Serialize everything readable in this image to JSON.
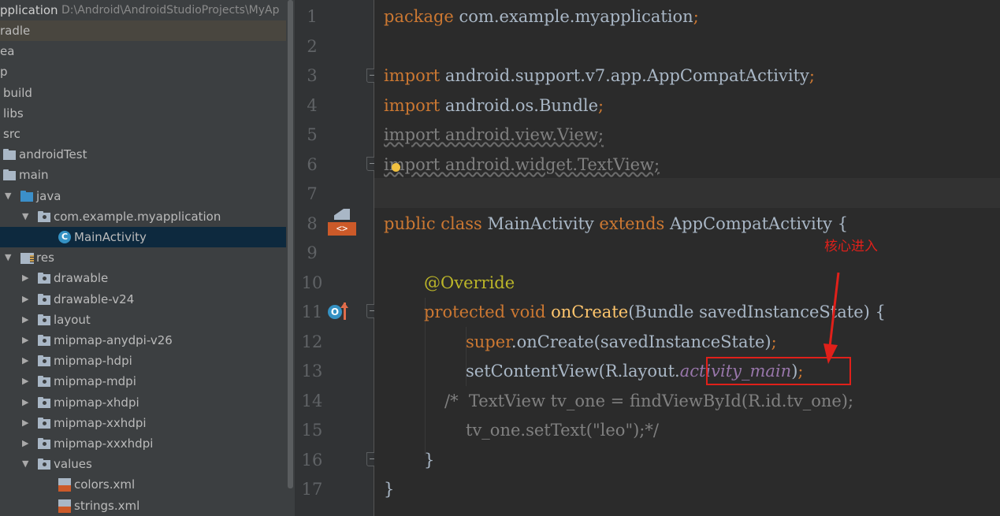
{
  "project": {
    "header_title": "pplication",
    "header_path": "D:\\Android\\AndroidStudioProjects\\MyAp",
    "items": [
      {
        "label": "radle",
        "icon": "none",
        "arrow": ""
      },
      {
        "label": "ea",
        "icon": "none",
        "arrow": ""
      },
      {
        "label": "p",
        "icon": "none",
        "arrow": ""
      },
      {
        "label": "build",
        "icon": "none",
        "arrow": ""
      },
      {
        "label": "libs",
        "icon": "none",
        "arrow": ""
      },
      {
        "label": "src",
        "icon": "none",
        "arrow": ""
      },
      {
        "label": "androidTest",
        "icon": "folder",
        "arrow": ""
      },
      {
        "label": "main",
        "icon": "folder",
        "arrow": ""
      },
      {
        "label": "java",
        "icon": "folder-blue",
        "arrow": "expanded"
      },
      {
        "label": "com.example.myapplication",
        "icon": "package-folder",
        "arrow": "expanded"
      },
      {
        "label": "MainActivity",
        "icon": "class-icon",
        "arrow": "",
        "badge": "C"
      },
      {
        "label": "res",
        "icon": "resource-folder",
        "arrow": "expanded"
      },
      {
        "label": "drawable",
        "icon": "package-folder",
        "arrow": "collapsed"
      },
      {
        "label": "drawable-v24",
        "icon": "package-folder",
        "arrow": "collapsed"
      },
      {
        "label": "layout",
        "icon": "package-folder",
        "arrow": "collapsed"
      },
      {
        "label": "mipmap-anydpi-v26",
        "icon": "package-folder",
        "arrow": "collapsed"
      },
      {
        "label": "mipmap-hdpi",
        "icon": "package-folder",
        "arrow": "collapsed"
      },
      {
        "label": "mipmap-mdpi",
        "icon": "package-folder",
        "arrow": "collapsed"
      },
      {
        "label": "mipmap-xhdpi",
        "icon": "package-folder",
        "arrow": "collapsed"
      },
      {
        "label": "mipmap-xxhdpi",
        "icon": "package-folder",
        "arrow": "collapsed"
      },
      {
        "label": "mipmap-xxxhdpi",
        "icon": "package-folder",
        "arrow": "collapsed"
      },
      {
        "label": "values",
        "icon": "package-folder",
        "arrow": "expanded"
      },
      {
        "label": "colors.xml",
        "icon": "xml-file",
        "arrow": ""
      },
      {
        "label": "strings.xml",
        "icon": "xml-file",
        "arrow": ""
      }
    ]
  },
  "editor": {
    "line_numbers": [
      "1",
      "2",
      "3",
      "4",
      "5",
      "6",
      "7",
      "8",
      "9",
      "10",
      "11",
      "12",
      "13",
      "14",
      "15",
      "16",
      "17"
    ],
    "gutter_icons": {
      "line8": "layout-preview-icon",
      "line11_badge": "O",
      "line11": "override-arrow-icon"
    },
    "lines": {
      "l1_kw": "package",
      "l1_rest": " com.example.myapplication",
      "l1_semi": ";",
      "l3_kw": "import",
      "l3_rest": " android.support.v7.app.AppCompatActivity",
      "l3_semi": ";",
      "l4_kw": "import",
      "l4_rest": " android.os.Bundle",
      "l4_semi": ";",
      "l5": "import android.view.View;",
      "l6": "import android.widget.TextView;",
      "l8_kw1": "public class ",
      "l8_name": "MainActivity ",
      "l8_kw2": "extends ",
      "l8_rest": "AppCompatActivity {",
      "l10": "@Override",
      "l11_kw": "protected void ",
      "l11_fn": "onCreate",
      "l11_rest": "(Bundle savedInstanceState) {",
      "l12_kw": "super",
      "l12_rest": ".onCreate(savedInstanceState)",
      "l12_semi": ";",
      "l13_pre": "setContentView(R.layout.",
      "l13_it": "activity_main",
      "l13_post": ")",
      "l13_semi": ";",
      "l14": "/*  TextView tv_one = findViewById(R.id.tv_one);",
      "l15": "tv_one.setText(\"leo\");*/",
      "l16": "}",
      "l17": "}"
    },
    "annotation_note": "核心进入",
    "colors": {
      "keyword": "#cc7832",
      "annotation_red": "#e0201a",
      "italic_field": "#9876aa"
    }
  }
}
